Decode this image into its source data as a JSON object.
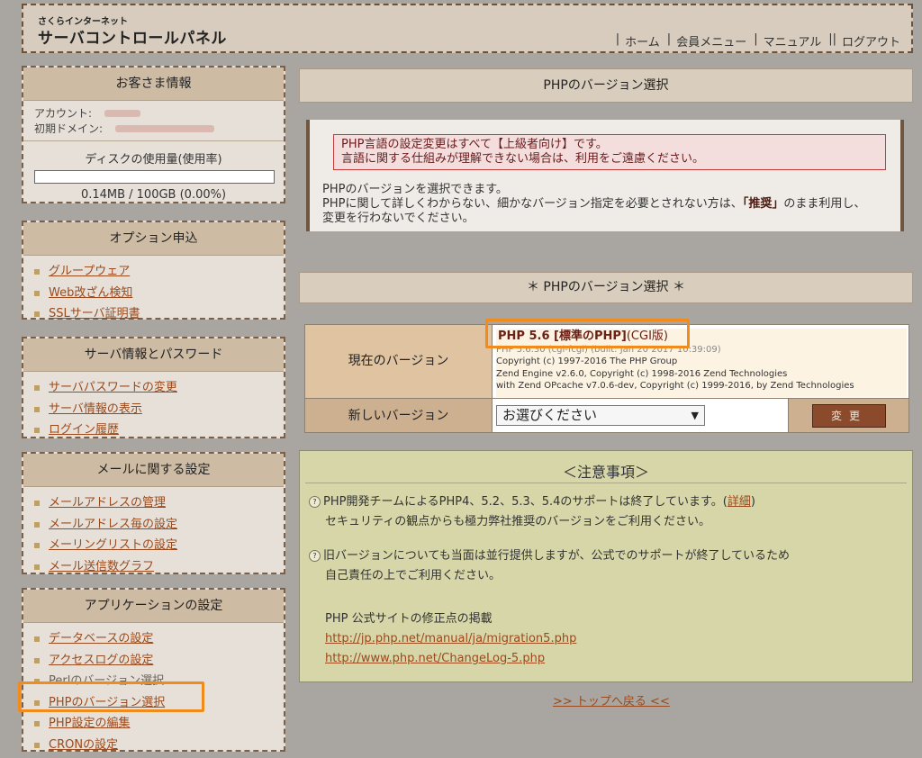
{
  "header": {
    "logo_sub": "さくらインターネット",
    "logo_main": "サーバコントロールパネル",
    "nav": [
      "ホーム",
      "会員メニュー",
      "マニュアル",
      "ログアウト"
    ]
  },
  "customer": {
    "title": "お客さま情報",
    "account_label": "アカウント:",
    "domain_label": "初期ドメイン:",
    "disk_title": "ディスクの使用量(使用率)",
    "disk_usage": "0.14MB / 100GB (0.00%)",
    "disk_usage_fraction": 0.0
  },
  "options": {
    "title": "オプション申込",
    "items": [
      "グループウェア",
      "Web改ざん検知",
      "SSLサーバ証明書"
    ]
  },
  "server_info": {
    "title": "サーバ情報とパスワード",
    "items": [
      "サーバパスワードの変更",
      "サーバ情報の表示",
      "ログイン履歴"
    ]
  },
  "mail": {
    "title": "メールに関する設定",
    "items": [
      "メールアドレスの管理",
      "メールアドレス毎の設定",
      "メーリングリストの設定",
      "メール送信数グラフ"
    ]
  },
  "apps": {
    "title": "アプリケーションの設定",
    "items": [
      "データベースの設定",
      "アクセスログの設定",
      "Perlのバージョン選択",
      "PHPのバージョン選択",
      "PHP設定の編集",
      "CRONの設定"
    ]
  },
  "main": {
    "title": "PHPのバージョン選択",
    "warning_line1": "PHP言語の設定変更はすべて【上級者向け】です。",
    "warning_line2": "言語に関する仕組みが理解できない場合は、利用をご遠慮ください。",
    "intro_line1": "PHPのバージョンを選択できます。",
    "intro_line2a": "PHPに関して詳しくわからない、細かなバージョン指定を必要とされない方は、",
    "intro_line2b": "「推奨」",
    "intro_line2c": "のまま利用し、",
    "intro_line3": "変更を行わないでください。",
    "section_title": "＊ PHPのバージョン選択 ＊"
  },
  "version_table": {
    "current_label": "現在のバージョン",
    "current_name": "PHP 5.6 [標準のPHP]",
    "current_type": "(CGI版)",
    "current_line2": "PHP 5.6.30 (cgi-fcgi) (built: Jan 20 2017 10:39:09)",
    "current_line3": "Copyright (c) 1997-2016 The PHP Group",
    "current_line4": "Zend Engine v2.6.0, Copyright (c) 1998-2016 Zend Technologies",
    "current_line5": "with Zend OPcache v7.0.6-dev, Copyright (c) 1999-2016, by Zend Technologies",
    "new_label": "新しいバージョン",
    "select_value": "お選びください",
    "change_button": "変更"
  },
  "notice": {
    "title": "＜注意事項＞",
    "item1_line1": "PHP開発チームによるPHP4、5.2、5.3、5.4のサポートは終了しています。(",
    "item1_link": "詳細",
    "item1_close": ")",
    "item1_line2": "セキュリティの観点からも極力弊社推奨のバージョンをご利用ください。",
    "item2_line1": "旧バージョンについても当面は並行提供しますが、公式でのサポートが終了しているため",
    "item2_line2": "自己責任の上でご利用ください。",
    "links_title": "PHP 公式サイトの修正点の掲載",
    "link1": "http://jp.php.net/manual/ja/migration5.php",
    "link2": "http://www.php.net/ChangeLog-5.php"
  },
  "back_to_top": ">> トップへ戻る <<",
  "colors": {
    "highlight": "#f08b1c",
    "accent_brown": "#8b4a2b",
    "notice_bg": "#d6d6a8"
  }
}
